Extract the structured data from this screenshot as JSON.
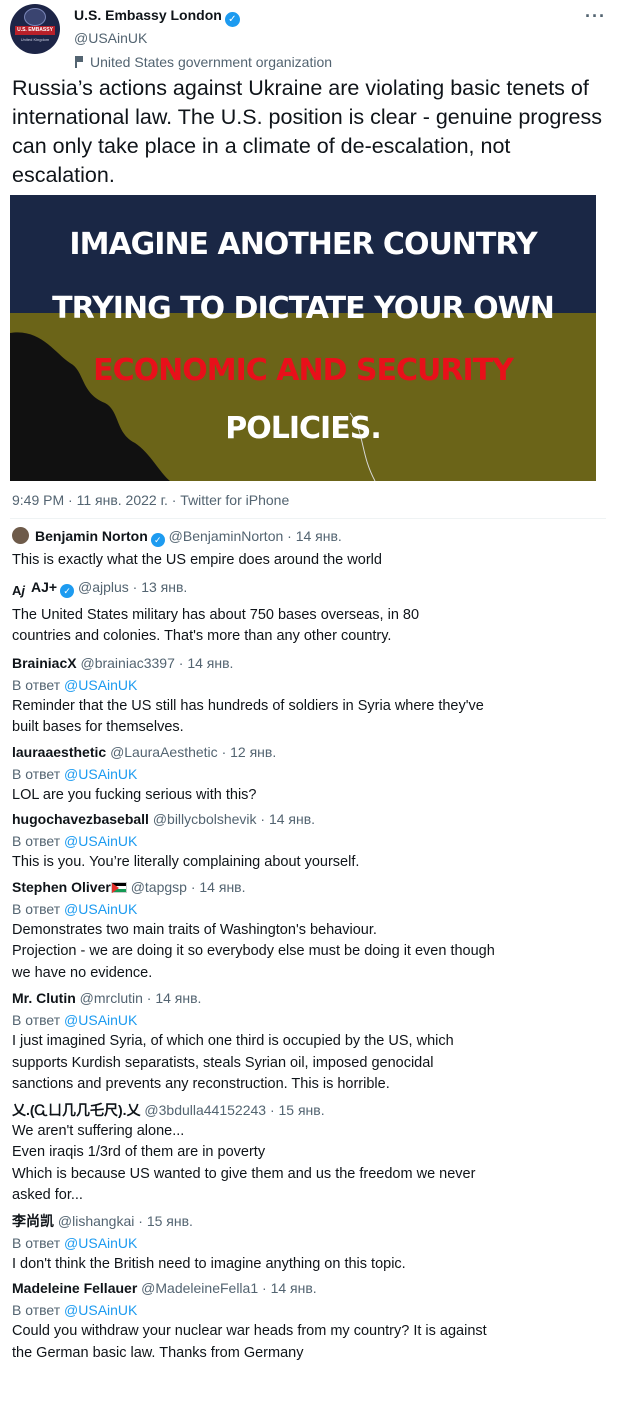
{
  "tweet": {
    "display_name": "U.S. Embassy London",
    "handle": "@USAinUK",
    "account_label": "United States government organization",
    "avatar_banner": "U.S. EMBASSY",
    "avatar_sub": "United Kingdom",
    "text": "Russia’s actions against Ukraine are violating basic tenets of international law. The U.S. position is clear - genuine progress can only take place in a climate of de-escalation, not escalation.",
    "image_lines": [
      "IMAGINE ANOTHER COUNTRY",
      "TRYING TO DICTATE YOUR OWN",
      "ECONOMIC AND SECURITY",
      "POLICIES."
    ],
    "meta": "9:49 PM · 11 янв. 2022 г. · Twitter for iPhone",
    "colors": {
      "verified": "#1d9bf0",
      "image_top": "#1a2745",
      "image_bottom": "#6b6418",
      "image_red": "#e8101a"
    }
  },
  "reply_prefix": "В ответ",
  "replies": [
    {
      "name": "Benjamin Norton",
      "verified": true,
      "handle": "@BenjaminNorton",
      "date": "· 14 янв.",
      "reply_to": "",
      "text": "This is exactly what the US empire does around the world"
    },
    {
      "name": "AJ+",
      "verified": true,
      "handle": "@ajplus",
      "date": "· 13 янв.",
      "reply_to": "",
      "text": "The United States military has about 750 bases overseas, in 80\ncountries and colonies. That's more than any other country."
    },
    {
      "name": "BrainiacX",
      "verified": false,
      "handle": "@brainiac3397",
      "date": "· 14 янв.",
      "reply_to": "@USAinUK",
      "text": "Reminder that the US still has hundreds of soldiers in Syria where they've\nbuilt bases for themselves."
    },
    {
      "name": "lauraaesthetic",
      "verified": false,
      "handle": "@LauraAesthetic",
      "date": "· 12 янв.",
      "reply_to": "@USAinUK",
      "text": "LOL are you fucking serious with this?"
    },
    {
      "name": "hugochavezbaseball",
      "verified": false,
      "handle": "@billycbolshevik",
      "date": "· 14 янв.",
      "reply_to": "@USAinUK",
      "text": "This is you. You’re literally complaining about yourself."
    },
    {
      "name": "Stephen Oliver",
      "verified": false,
      "flag": true,
      "handle": "@tapgsp",
      "date": "· 14 янв.",
      "reply_to": "@USAinUK",
      "text": "Demonstrates two main traits of Washington's behaviour.\nProjection - we are doing it so everybody else must be doing it even though\nwe have no evidence."
    },
    {
      "name": "Mr. Clutin",
      "verified": false,
      "handle": "@mrclutin",
      "date": "· 14 янв.",
      "reply_to": "@USAinUK",
      "text": "I just imagined Syria, of which one third is occupied by the US, which\nsupports Kurdish separatists, steals Syrian oil, imposed genocidal\nsanctions and prevents any reconstruction. This is horrible."
    },
    {
      "name": "乂.(Ꮹㄩ几几乇尺).乂",
      "verified": false,
      "handle": "@3bdulla44152243",
      "date": "· 15 янв.",
      "reply_to": "",
      "text": "We aren't suffering alone...\nEven iraqis 1/3rd of them are in poverty\nWhich is because US wanted to give them and us the freedom we never\nasked for..."
    },
    {
      "name": "李尚凯",
      "verified": false,
      "handle": "@lishangkai",
      "date": "· 15 янв.",
      "reply_to": "@USAinUK",
      "text": "I don't think the British need to imagine anything on this topic."
    },
    {
      "name": "Madeleine Fellauer",
      "verified": false,
      "handle": "@MadeleineFella1",
      "date": "· 14 янв.",
      "reply_to": "@USAinUK",
      "text": "Could you withdraw your nuclear war heads from my country? It is against\nthe German basic law.  Thanks from Germany"
    }
  ]
}
